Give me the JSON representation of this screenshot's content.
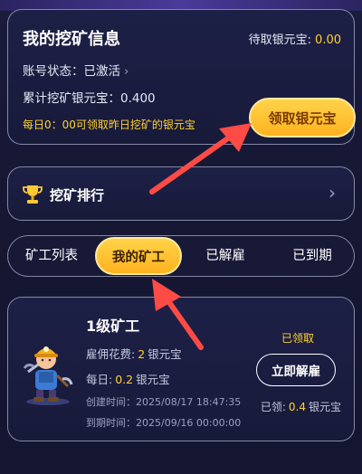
{
  "info": {
    "title": "我的挖矿信息",
    "pending_label": "待取银元宝:",
    "pending_value": "0.00",
    "status_text": "账号状态：已激活",
    "total_text": "累计挖矿银元宝：0.400",
    "daily_note": "每日0：00可领取昨日挖矿的银元宝",
    "claim_button": "领取银元宝"
  },
  "ranking": {
    "label": "挖矿排行"
  },
  "tabs": [
    "矿工列表",
    "我的矿工",
    "已解雇",
    "已到期"
  ],
  "worker": {
    "name": "1级矿工",
    "hire_label": "雇佣花费:",
    "hire_value": "2",
    "hire_unit": "银元宝",
    "daily_label": "每日:",
    "daily_value": "0.2",
    "daily_unit": "银元宝",
    "created": "创建时间：2025/08/17 18:47:35",
    "expires": "到期时间：2025/09/16 00:00:00",
    "claimed_status": "已领取",
    "fire_button": "立即解雇",
    "claimed_label": "已领:",
    "claimed_value": "0.4",
    "claimed_unit": "银元宝"
  },
  "colors": {
    "accent": "#ffd22e",
    "arrow": "#ff4b45"
  }
}
